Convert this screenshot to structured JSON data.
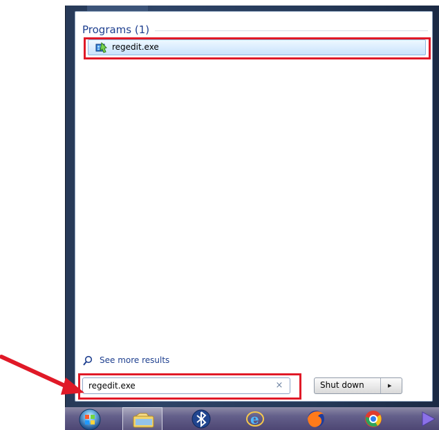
{
  "start_menu": {
    "programs_section_title": "Programs (1)",
    "search_result": {
      "label": "regedit.exe",
      "icon": "regedit-icon"
    },
    "see_more_results": {
      "label": "See more results",
      "icon": "search-icon"
    },
    "search_box": {
      "value": "regedit.exe",
      "clear_icon": "clear-icon",
      "clear_symbol": "×"
    },
    "shutdown": {
      "label": "Shut down",
      "arrow_icon": "chevron-right-icon",
      "arrow_symbol": "▸"
    }
  },
  "annotation": {
    "highlight_color": "#e01927",
    "arrow_color": "#e01927"
  },
  "taskbar": {
    "items": [
      {
        "name": "start-orb",
        "icon": "windows-orb-icon"
      },
      {
        "name": "windows-explorer",
        "icon": "folder-icon"
      },
      {
        "name": "bluetooth",
        "icon": "bluetooth-icon"
      },
      {
        "name": "internet-explorer",
        "icon": "internet-explorer-icon"
      },
      {
        "name": "firefox",
        "icon": "firefox-icon"
      },
      {
        "name": "chrome",
        "icon": "chrome-icon"
      },
      {
        "name": "media-player",
        "icon": "media-player-icon"
      }
    ]
  }
}
